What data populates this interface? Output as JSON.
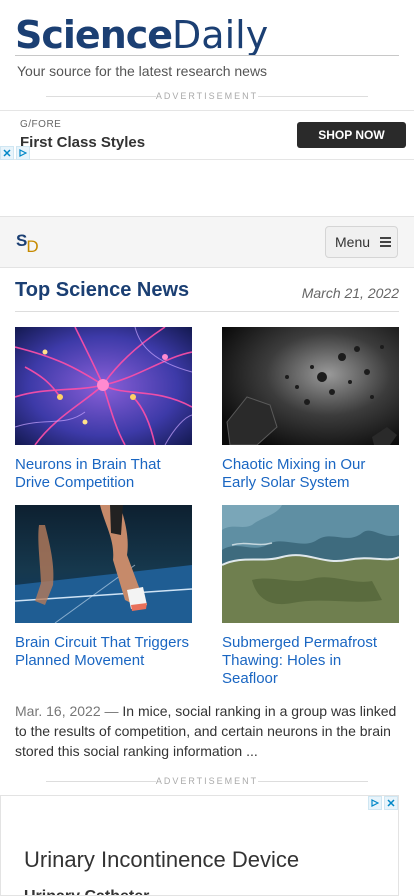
{
  "site": {
    "logo_part1": "Science",
    "logo_part2": "Daily",
    "tagline": "Your source for the latest research news"
  },
  "ads": {
    "label": "ADVERTISEMENT",
    "top": {
      "brand": "G/FORE",
      "headline": "First Class Styles",
      "button": "SHOP NOW"
    },
    "bottom": {
      "headline": "Urinary Incontinence Device",
      "subline": "Urinary Catheter"
    }
  },
  "nav": {
    "logo_s": "S",
    "logo_d": "D",
    "menu_label": "Menu"
  },
  "top_news": {
    "title": "Top Science News",
    "date": "March 21, 2022",
    "stories": [
      {
        "title": "Neurons in Brain That Drive Competition",
        "image": "neurons-illustration"
      },
      {
        "title": "Chaotic Mixing in Our Early Solar System",
        "image": "asteroid-debris"
      },
      {
        "title": "Brain Circuit That Triggers Planned Movement",
        "image": "sprinter-start"
      },
      {
        "title": "Submerged Permafrost Thawing: Holes in Seafloor",
        "image": "arctic-satellite"
      }
    ],
    "summary": {
      "date": "Mar. 16, 2022",
      "separator": "—",
      "text": "In mice, social ranking in a group was linked to the results of competition, and certain neurons in the brain stored this social ranking information ..."
    }
  },
  "colors": {
    "brand_blue": "#1b3f73",
    "link_blue": "#1a66c2",
    "accent_gold": "#c68a00"
  },
  "icons": [
    "adchoices-icon",
    "close-icon",
    "hamburger-icon"
  ]
}
